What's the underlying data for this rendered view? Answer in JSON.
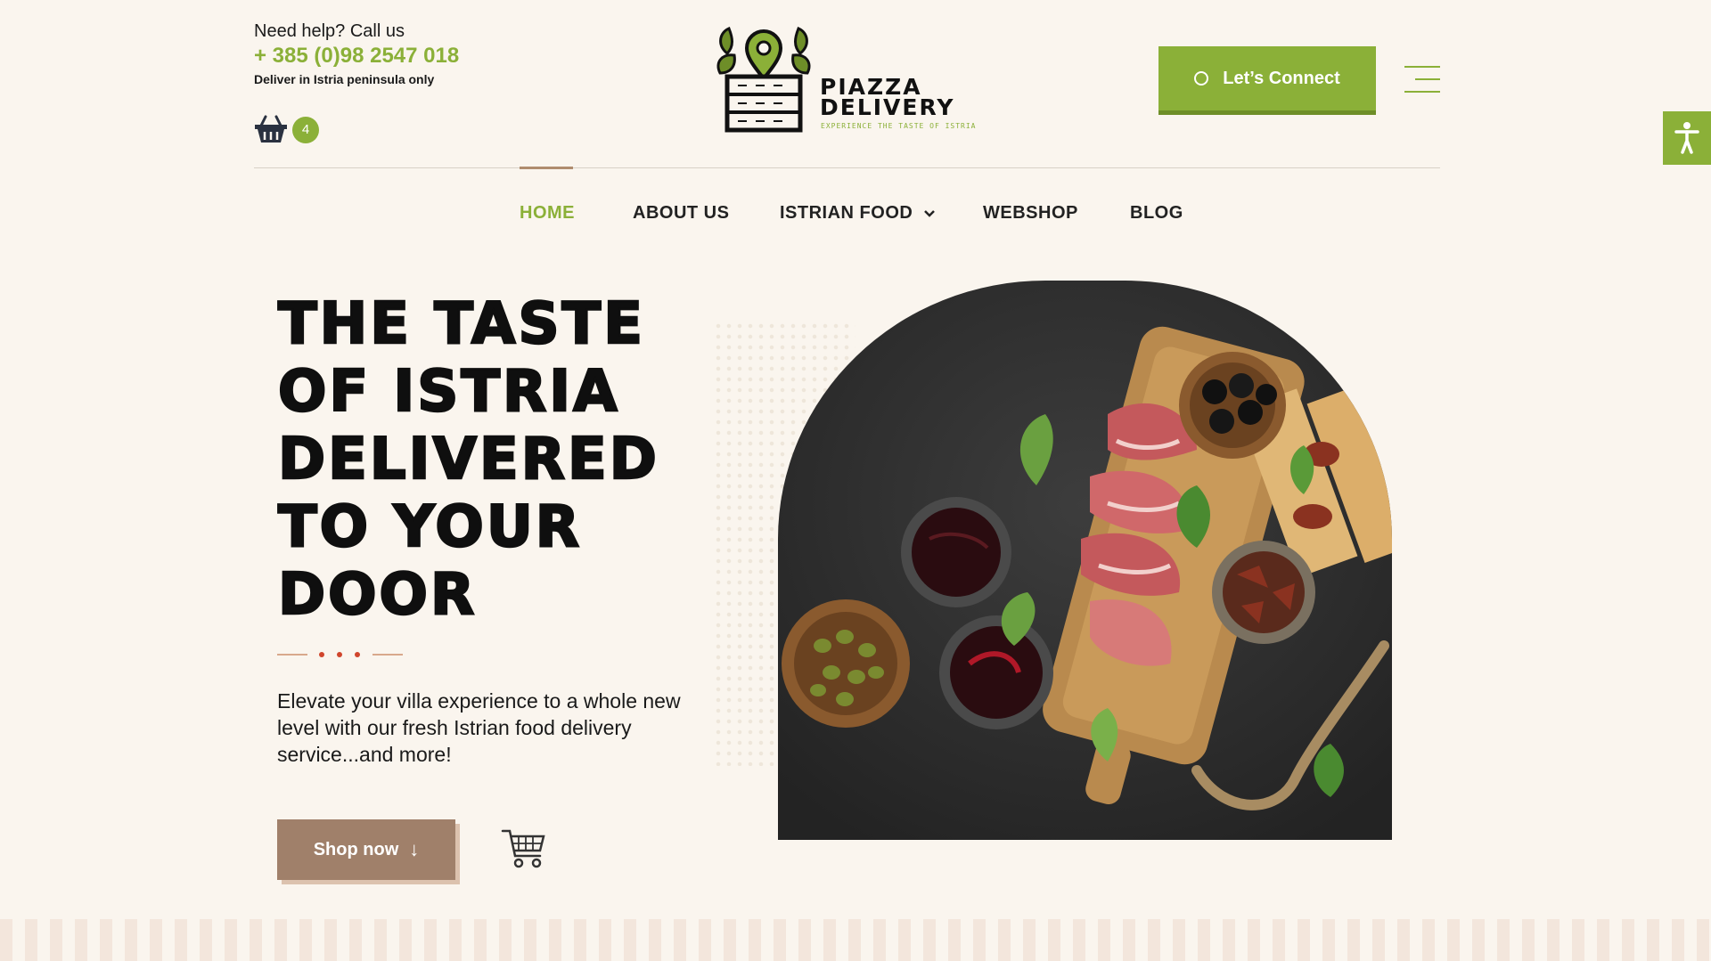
{
  "header": {
    "help_text": "Need help? Call us",
    "phone": "+ 385 (0)98 2547 018",
    "deliver_note": "Deliver in Istria peninsula only",
    "cart_count": "4",
    "connect_label": "Let’s Connect"
  },
  "logo": {
    "line1": "PIAZZA",
    "line2": "DELIVERY",
    "tagline": "EXPERIENCE THE TASTE OF ISTRIA"
  },
  "nav": {
    "items": [
      {
        "label": "HOME",
        "active": true
      },
      {
        "label": "ABOUT US"
      },
      {
        "label": "ISTRIAN FOOD",
        "has_dropdown": true
      },
      {
        "label": "WEBSHOP"
      },
      {
        "label": "BLOG"
      }
    ]
  },
  "hero": {
    "title_lines": [
      "THE TASTE",
      "OF ISTRIA",
      "DELIVERED",
      "TO YOUR",
      "DOOR"
    ],
    "subtitle": "Elevate your villa experience to a whole new level with our fresh Istrian food delivery service...and more!",
    "shop_label": "Shop now",
    "image_icon": "charcuterie-board-image"
  },
  "colors": {
    "accent_green": "#8bb038",
    "brown": "#a0806a",
    "background": "#faf5ee",
    "dot_red": "#d0452c"
  },
  "icons": {
    "basket": "basket-icon",
    "accessibility": "accessibility-icon",
    "menu": "hamburger-menu-icon",
    "cart": "shopping-cart-icon",
    "arrow": "arrow-down-icon",
    "chevron": "chevron-down-icon"
  }
}
